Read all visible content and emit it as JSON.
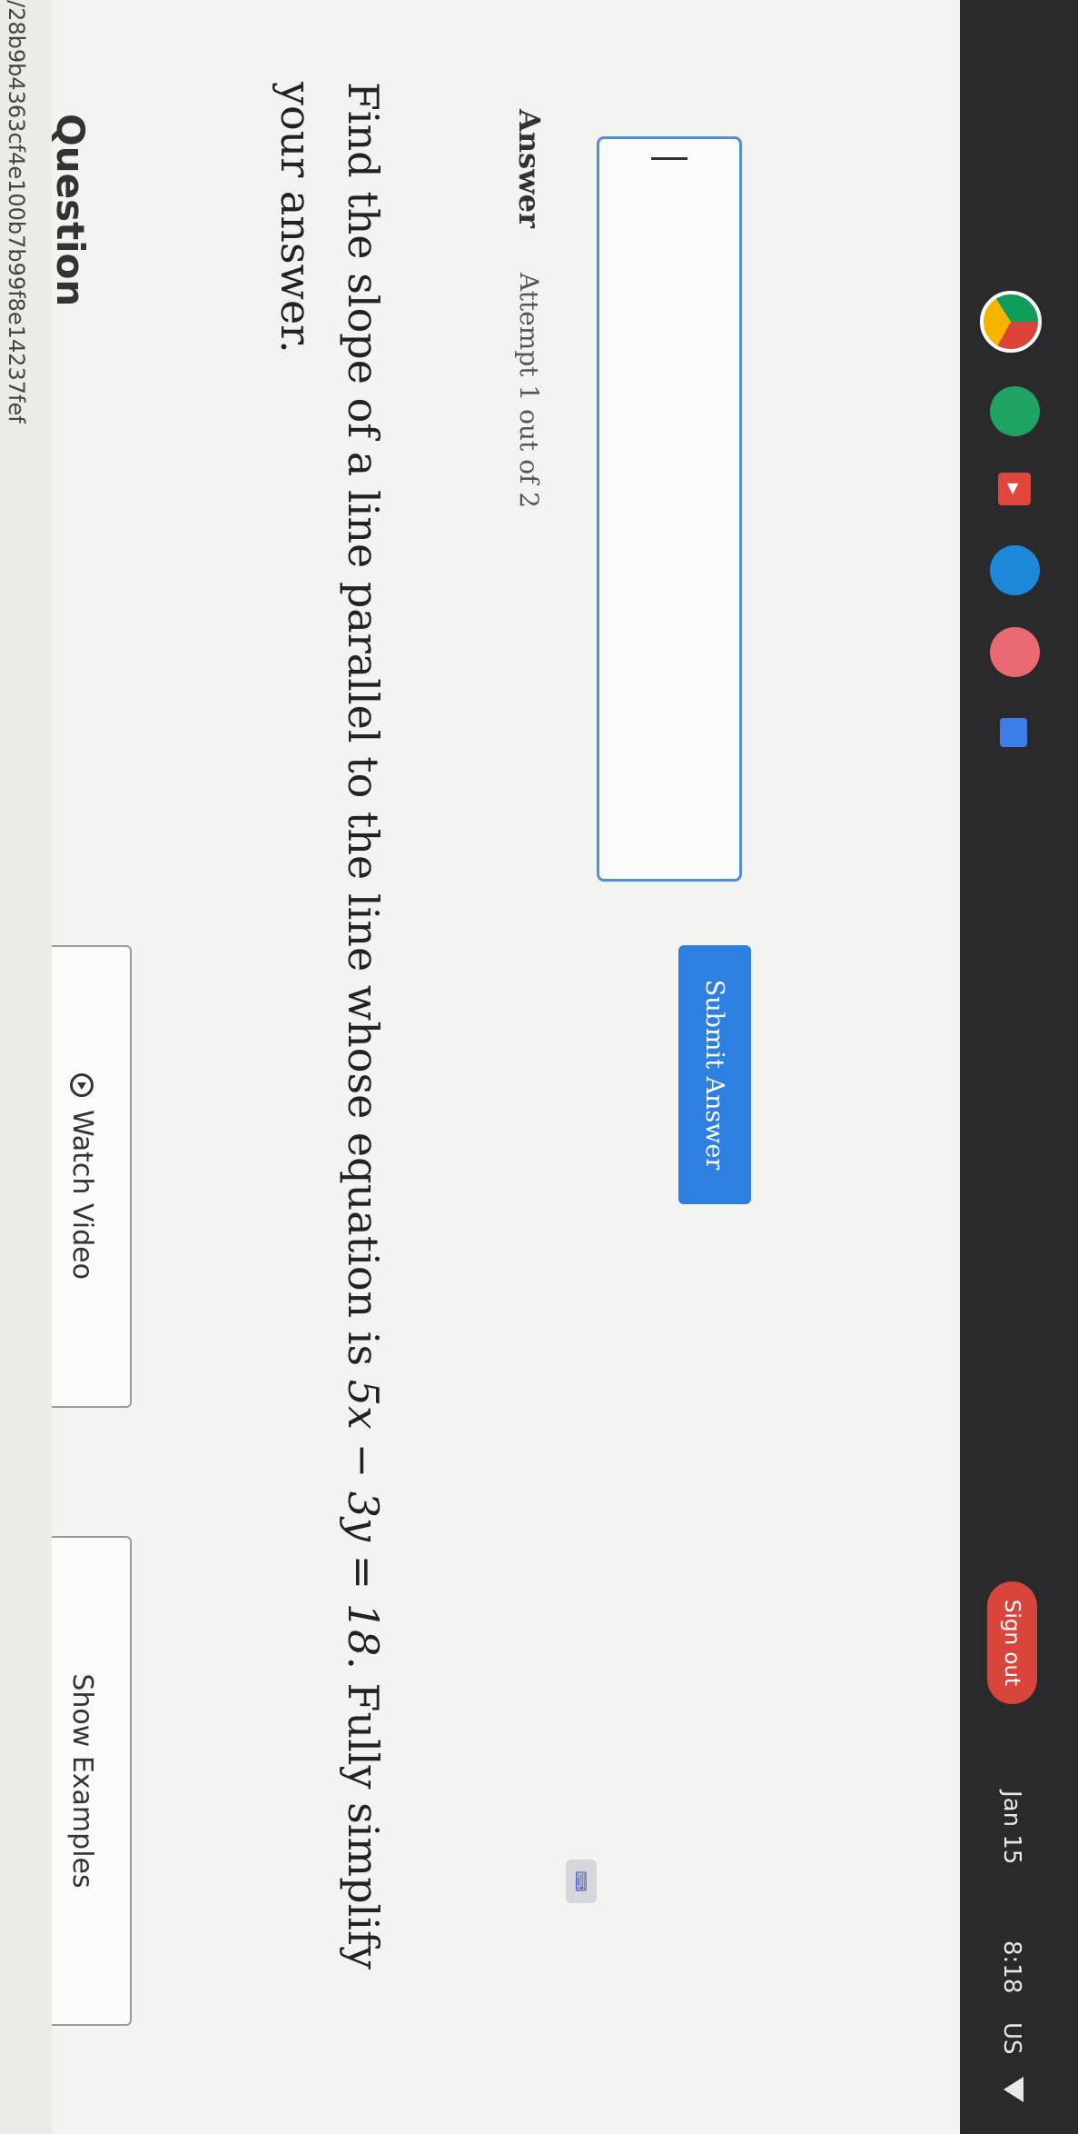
{
  "url_fragment": "/28b9b4363cf4e100b7b99f8e14237fef",
  "question": {
    "heading": "Question",
    "text_before": "Find the slope of a line parallel to the line whose equation is ",
    "equation": "5x − 3y = 18",
    "text_after": ". Fully simplify your answer."
  },
  "buttons": {
    "watch_video": "Watch Video",
    "show_examples": "Show Examples",
    "submit": "Submit Answer"
  },
  "answer": {
    "label": "Answer",
    "attempt": "Attempt 1 out of 2",
    "value": ""
  },
  "shelf": {
    "sign_out": "Sign out",
    "date": "Jan 15",
    "time": "8:18",
    "locale": "US"
  },
  "colors": {
    "accent": "#2d7fe0",
    "input_border": "#4f8fd8",
    "sign_out": "#d9453a"
  }
}
